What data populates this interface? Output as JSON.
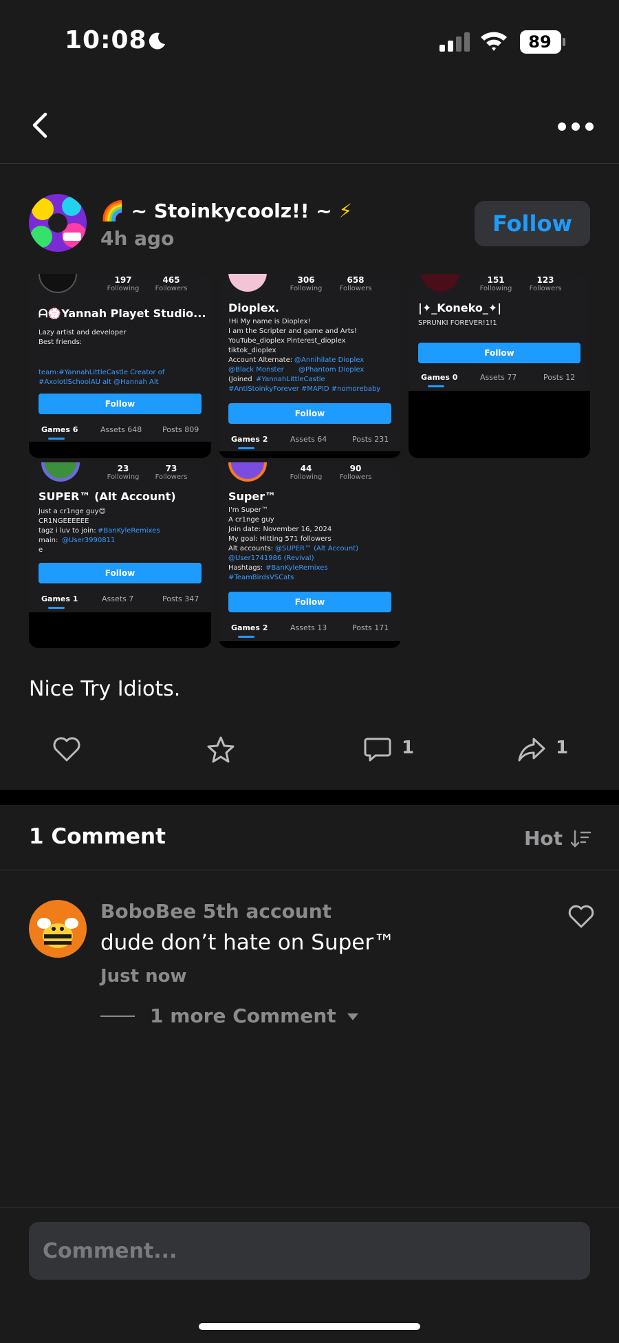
{
  "status": {
    "time": "10:08",
    "battery": "89"
  },
  "post": {
    "author": "~ Stoinkycoolz!! ~",
    "author_prefix_emoji": "🌈",
    "author_suffix_emoji": "⚡",
    "time": "4h ago",
    "follow_label": "Follow",
    "caption": "Nice Try Idiots."
  },
  "cards": [
    {
      "name": "ᗩ💮Yannah Playet Studio...",
      "following": "197",
      "followers": "465",
      "following_label": "Following",
      "followers_label": "Followers",
      "bio": [
        "Lazy artist and developer",
        "Best friends:"
      ],
      "bio_links": [
        "team:#YannahLittleCastle  Creator of",
        "#AxolotlSchoolAU  alt @Hannah Alt"
      ],
      "follow_label": "Follow",
      "tabs": [
        "Games 6",
        "Assets 648",
        "Posts 809"
      ]
    },
    {
      "name": "Dioplex.",
      "following": "306",
      "followers": "658",
      "following_label": "Following",
      "followers_label": "Followers",
      "bio": [
        "!Hi My name is Dioplex!",
        "I am the Scripter and game and Arts!",
        "YouTube_dioplex Pinterest_dioplex",
        "tiktok_dioplex",
        "Account Alternate:",
        "(Joined"
      ],
      "bio_links": [
        "@Annihilate Dioplex",
        "@Black Monster",
        "@Phantom Dioplex",
        "#YannahLittleCastle",
        "#AntiStoinkyForever  #MAPID  #nomorebaby"
      ],
      "follow_label": "Follow",
      "tabs": [
        "Games 2",
        "Assets 64",
        "Posts 231"
      ]
    },
    {
      "name": "|✦_Koneko_✦|",
      "following": "151",
      "followers": "123",
      "following_label": "Following",
      "followers_label": "Followers",
      "bio": [
        "SPRUNKI FOREVER!1!1"
      ],
      "follow_label": "Follow",
      "tabs": [
        "Games 0",
        "Assets 77",
        "Posts 12"
      ]
    },
    {
      "name": "SUPER™ (Alt Account)",
      "following": "23",
      "followers": "73",
      "following_label": "Following",
      "followers_label": "Followers",
      "bio": [
        "Just a cr1nge guy😊",
        "CR1NGEEEEEE",
        "tagz i luv to join:",
        "main:",
        "e"
      ],
      "bio_links": [
        "#BanKyleRemixes",
        "@User3990811"
      ],
      "follow_label": "Follow",
      "tabs": [
        "Games 1",
        "Assets 7",
        "Posts 347"
      ]
    },
    {
      "name": "Super™",
      "following": "44",
      "followers": "90",
      "following_label": "Following",
      "followers_label": "Followers",
      "bio": [
        "I'm Super™",
        "A cr1nge guy",
        "Join date: November 16, 2024",
        "My goal: Hitting 571 followers",
        "Alt accounts:",
        "Hashtags:"
      ],
      "bio_links": [
        "@SUPER™ (Alt Account)",
        "@User1741986 (Revival)",
        "#BanKyleRemixes",
        "#TeamBirdsVSCats"
      ],
      "follow_label": "Follow",
      "tabs": [
        "Games 2",
        "Assets 13",
        "Posts 171"
      ]
    }
  ],
  "actions": {
    "comment_count": "1",
    "share_count": "1"
  },
  "comments": {
    "title": "1 Comment",
    "sort": "Hot",
    "items": [
      {
        "author": "BoboBee 5th account",
        "text": "dude don’t hate on Super™",
        "time": "Just now",
        "more": "1 more Comment"
      }
    ]
  },
  "composer": {
    "placeholder": "Comment..."
  },
  "colors": {
    "accent": "#1e9bff",
    "background": "#1b1b1c",
    "muted": "#8a8a8d"
  }
}
